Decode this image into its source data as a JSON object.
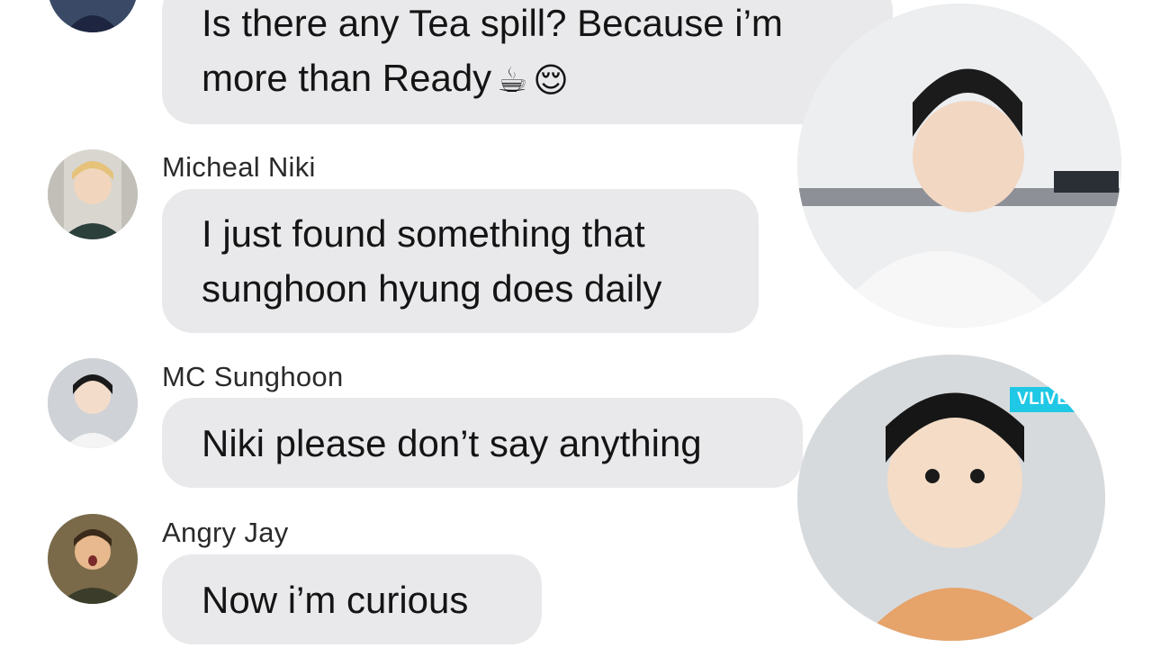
{
  "messages": [
    {
      "sender": "",
      "lines": [
        "Is there any Tea spill? Because i’m",
        "more than Ready"
      ],
      "emojis": [
        "☕",
        "😌"
      ]
    },
    {
      "sender": "Micheal Niki",
      "lines": [
        "I just found something that",
        "sunghoon hyung does daily"
      ]
    },
    {
      "sender": "MC Sunghoon",
      "lines": [
        "Niki please don’t say anything"
      ]
    },
    {
      "sender": "Angry Jay",
      "lines": [
        "Now i’m curious"
      ]
    }
  ],
  "overlay": {
    "watermark": "VLIVE"
  },
  "colors": {
    "bubble": "#e9e9eb",
    "text": "#141414",
    "sender": "#2a2a2a",
    "vlive_badge": "#1fc8e4"
  }
}
